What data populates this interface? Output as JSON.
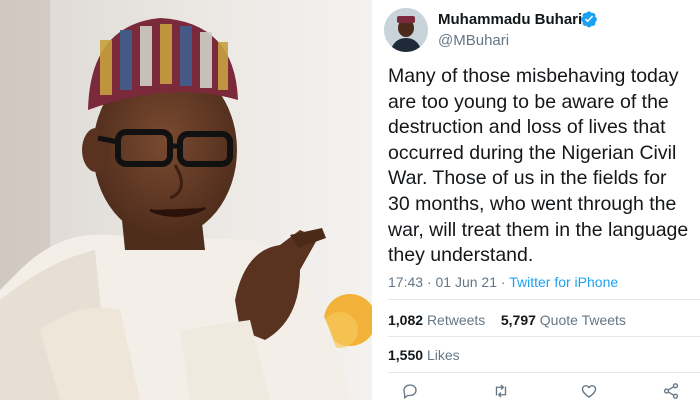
{
  "tweet": {
    "author_name": "Muhammadu Buhari",
    "author_handle": "@MBuhari",
    "text_lines": [
      "Many of those misbehaving today",
      "are too young to be aware of the",
      "destruction and loss of lives that",
      "occurred during the Nigerian Civil",
      "War. Those of us in the fields for",
      "30 months, who went through the",
      "war, will treat them in the language",
      "they understand."
    ],
    "time": "17:43",
    "date": "01 Jun 21",
    "source": "Twitter for iPhone",
    "retweets_count": "1,082",
    "retweets_label": "Retweets",
    "quote_count": "5,797",
    "quote_label": "Quote Tweets",
    "likes_count": "1,550",
    "likes_label": "Likes"
  },
  "colors": {
    "link": "#1da1f2",
    "muted": "#657786",
    "text": "#14171a",
    "divider": "#e1e8ed"
  },
  "icons": [
    "verified-badge-icon",
    "reply-icon",
    "retweet-icon",
    "like-icon",
    "share-icon"
  ]
}
